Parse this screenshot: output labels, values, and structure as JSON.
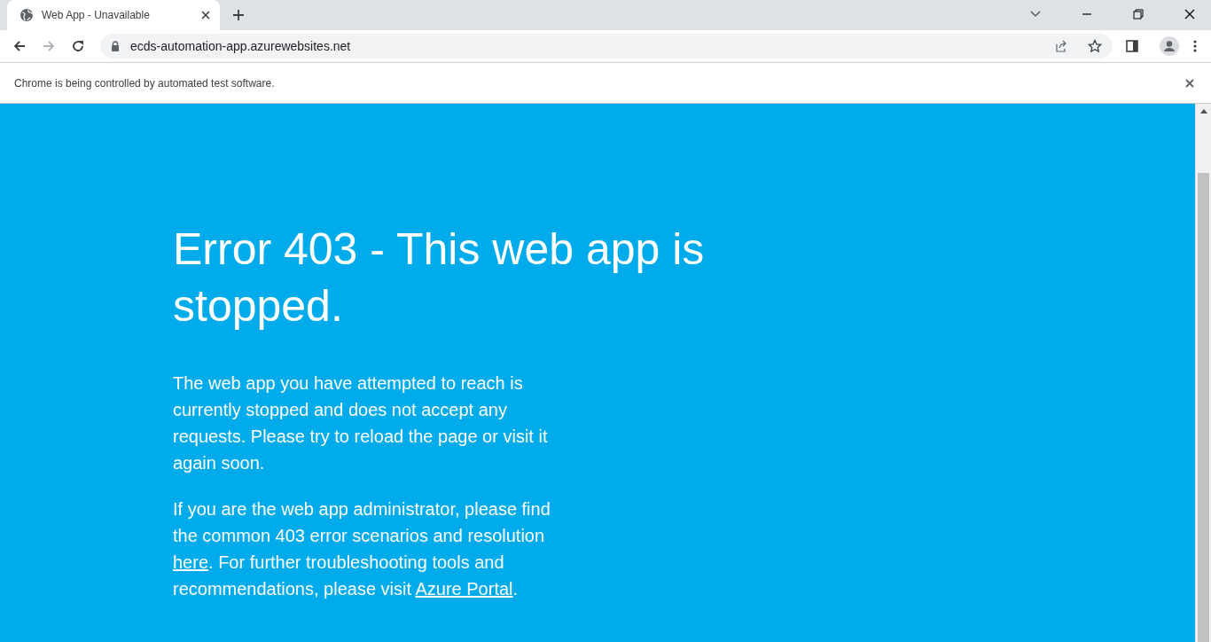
{
  "tab": {
    "title": "Web App - Unavailable",
    "selected": true
  },
  "address_bar": {
    "url": "ecds-automation-app.azurewebsites.net"
  },
  "infobar": {
    "message": "Chrome is being controlled by automated test software."
  },
  "page": {
    "heading": "Error 403 - This web app is stopped.",
    "paragraphs": [
      [
        {
          "kind": "text",
          "text": "The web app you have attempted to reach is currently stopped and does not accept any requests. Please try to reload the page or visit it again soon."
        }
      ],
      [
        {
          "kind": "text",
          "text": "If you are the web app administrator, please find the common 403 error scenarios and resolution "
        },
        {
          "kind": "link",
          "text": "here"
        },
        {
          "kind": "text",
          "text": ". For further troubleshooting tools and recommendations, please visit "
        },
        {
          "kind": "link",
          "text": "Azure Portal"
        },
        {
          "kind": "text",
          "text": "."
        }
      ]
    ]
  }
}
